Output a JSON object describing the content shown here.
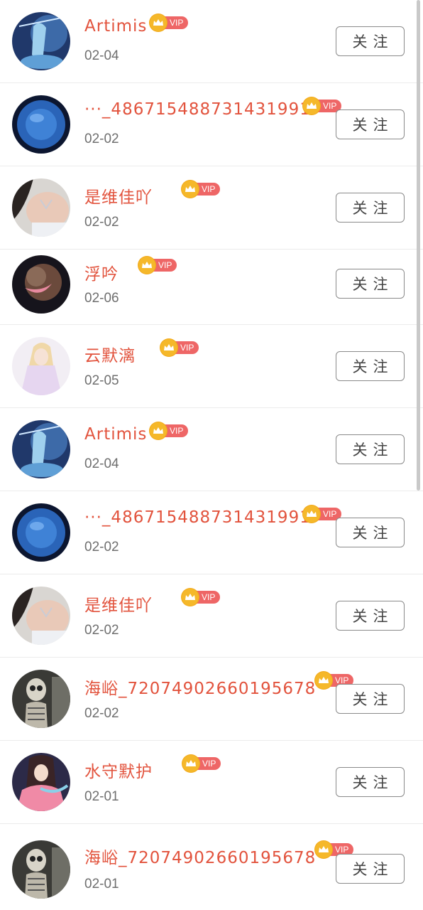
{
  "follow_label": "关注",
  "vip_label": "VIP",
  "rows": [
    {
      "name": "Artimis",
      "date": "02-04",
      "avatar": "avatar-archer"
    },
    {
      "name": "···_486715488731431991",
      "date": "02-02",
      "avatar": "avatar-blue-circle"
    },
    {
      "name": "是维佳吖",
      "date": "02-02",
      "avatar": "avatar-neck-jewel"
    },
    {
      "name": "浮吟",
      "date": "02-06",
      "avatar": "avatar-cloud-moon"
    },
    {
      "name": "云默漓",
      "date": "02-05",
      "avatar": "avatar-anime-white"
    },
    {
      "name": "Artimis",
      "date": "02-04",
      "avatar": "avatar-archer"
    },
    {
      "name": "···_486715488731431991",
      "date": "02-02",
      "avatar": "avatar-blue-circle"
    },
    {
      "name": "是维佳吖",
      "date": "02-02",
      "avatar": "avatar-neck-jewel"
    },
    {
      "name": "海峪_72074902660195678",
      "date": "02-02",
      "avatar": "avatar-skeleton"
    },
    {
      "name": "水守默护",
      "date": "02-01",
      "avatar": "avatar-anime-pink"
    },
    {
      "name": "海峪_72074902660195678",
      "date": "02-01",
      "avatar": "avatar-skeleton"
    }
  ]
}
